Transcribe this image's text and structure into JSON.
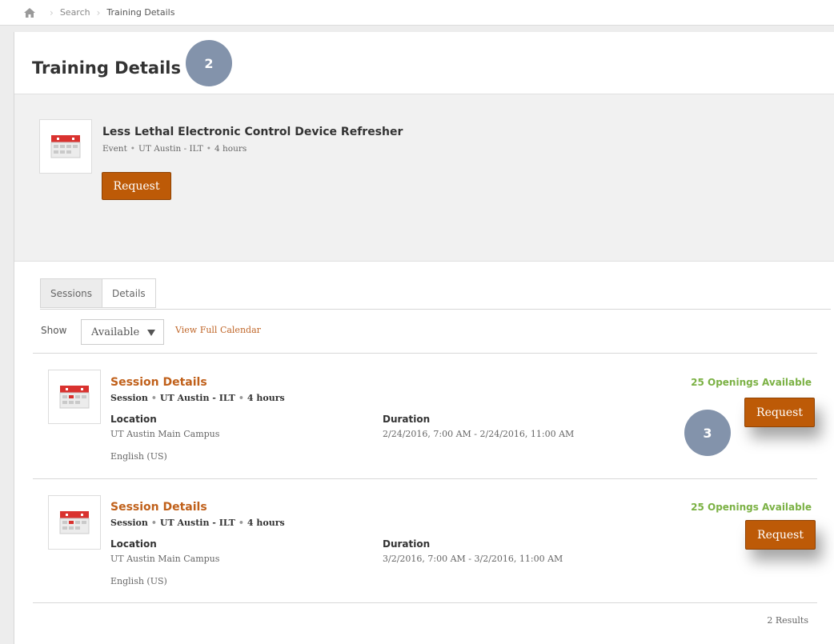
{
  "breadcrumb": {
    "home_icon": "home-icon",
    "items": [
      "Search",
      "Training Details"
    ]
  },
  "page": {
    "title": "Training Details"
  },
  "callouts": {
    "badge_a": "2",
    "badge_b": "3"
  },
  "training": {
    "title": "Less Lethal Electronic Control Device Refresher",
    "type": "Event",
    "provider": "UT Austin - ILT",
    "duration": "4 hours",
    "request_label": "Request",
    "icon": "calendar-icon"
  },
  "tabs": [
    {
      "label": "Sessions",
      "active": true
    },
    {
      "label": "Details",
      "active": false
    }
  ],
  "filter": {
    "show_label": "Show",
    "selected": "Available",
    "calendar_link": "View Full Calendar"
  },
  "sessions": [
    {
      "title": "Session Details",
      "type": "Session",
      "provider": "UT Austin - ILT",
      "duration": "4 hours",
      "location_label": "Location",
      "location": "UT Austin Main Campus",
      "language": "English (US)",
      "duration_label": "Duration",
      "dates": "2/24/2016, 7:00 AM - 2/24/2016, 11:00 AM",
      "openings": "25 Openings Available",
      "request_label": "Request"
    },
    {
      "title": "Session Details",
      "type": "Session",
      "provider": "UT Austin - ILT",
      "duration": "4 hours",
      "location_label": "Location",
      "location": "UT Austin Main Campus",
      "language": "English (US)",
      "duration_label": "Duration",
      "dates": "3/2/2016, 7:00 AM - 3/2/2016, 11:00 AM",
      "openings": "25 Openings Available",
      "request_label": "Request"
    }
  ],
  "results": "2 Results",
  "colors": {
    "accent": "#bd5a07",
    "link": "#c0601a",
    "success": "#7bb144",
    "callout": "#8393ab"
  }
}
